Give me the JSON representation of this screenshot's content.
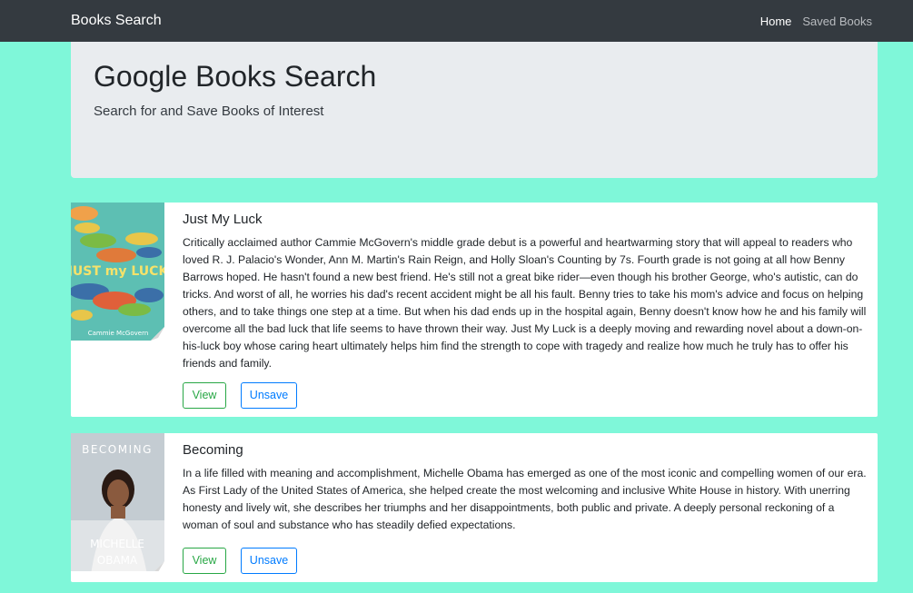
{
  "navbar": {
    "brand": "Books Search",
    "links": [
      {
        "label": "Home"
      },
      {
        "label": "Saved Books"
      }
    ]
  },
  "jumbotron": {
    "title": "Google Books Search",
    "subtitle": "Search for and Save Books of Interest"
  },
  "books": [
    {
      "title": "Just My Luck",
      "description": "Critically acclaimed author Cammie McGovern's middle grade debut is a powerful and heartwarming story that will appeal to readers who loved R. J. Palacio's Wonder, Ann M. Martin's Rain Reign, and Holly Sloan's Counting by 7s. Fourth grade is not going at all how Benny Barrows hoped. He hasn't found a new best friend. He's still not a great bike rider—even though his brother George, who's autistic, can do tricks. And worst of all, he worries his dad's recent accident might be all his fault. Benny tries to take his mom's advice and focus on helping others, and to take things one step at a time. But when his dad ends up in the hospital again, Benny doesn't know how he and his family will overcome all the bad luck that life seems to have thrown their way. Just My Luck is a deeply moving and rewarding novel about a down-on-his-luck boy whose caring heart ultimately helps him find the strength to cope with tragedy and realize how much he truly has to offer his friends and family.",
      "cover": {
        "title_text": "JUST my LUCK",
        "author_text": "Cammie McGovern"
      },
      "view_label": "View",
      "unsave_label": "Unsave"
    },
    {
      "title": "Becoming",
      "description": "In a life filled with meaning and accomplishment, Michelle Obama has emerged as one of the most iconic and compelling women of our era. As First Lady of the United States of America, she helped create the most welcoming and inclusive White House in history. With unerring honesty and lively wit, she describes her triumphs and her disappointments, both public and private. A deeply personal reckoning of a woman of soul and substance who has steadily defied expectations.",
      "cover": {
        "title_text": "BECOMING",
        "author_line1": "MICHELLE",
        "author_line2": "OBAMA"
      },
      "view_label": "View",
      "unsave_label": "Unsave"
    }
  ]
}
